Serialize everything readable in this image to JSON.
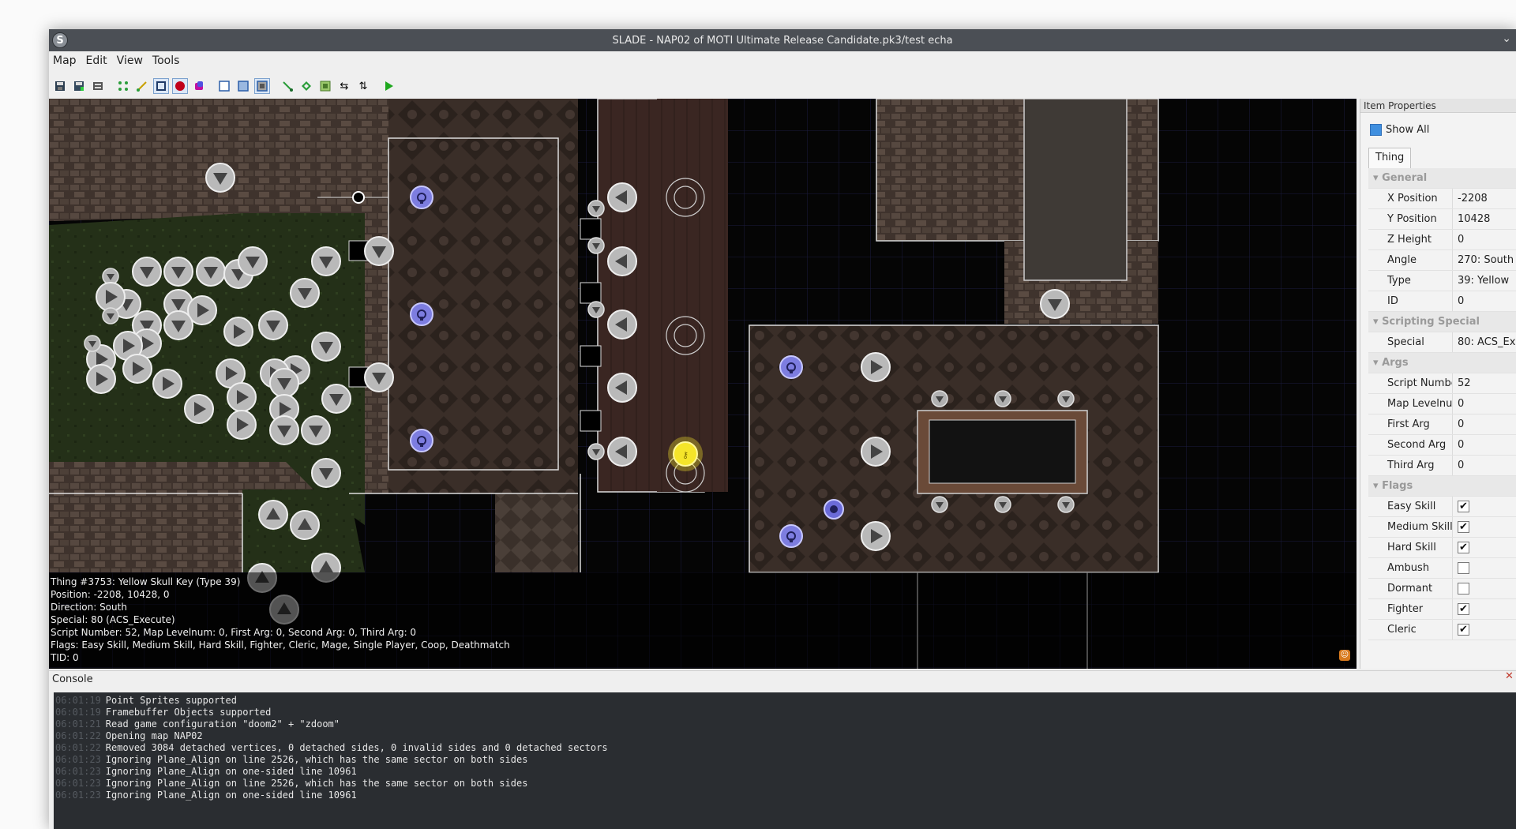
{
  "window": {
    "title": "SLADE - NAP02 of MOTI Ultimate Release Candidate.pk3/test echa",
    "app_icon": "slade-logo-icon"
  },
  "menu": [
    "Map",
    "Edit",
    "View",
    "Tools"
  ],
  "toolbar": {
    "icons": [
      "save-icon",
      "save-all-icon",
      "export-icon",
      "vertices-mode-icon",
      "lines-mode-icon",
      "sectors-mode-icon",
      "things-mode-icon",
      "3d-mode-icon",
      "flat-mode-icon",
      "floor-mode-icon",
      "ceiling-mode-icon",
      "grid-icon",
      "lines-draw-icon",
      "objects-icon",
      "editor-tags-icon",
      "swap-icon",
      "flip-icon",
      "play-icon"
    ]
  },
  "map_info": {
    "line1": "Thing #3753: Yellow Skull Key (Type 39)",
    "line2": "Position: -2208, 10428, 0",
    "line3": "Direction: South",
    "line4": "Special: 80 (ACS_Execute)",
    "line5": "Script Number: 52, Map Levelnum: 0, First Arg: 0, Second Arg: 0, Third Arg: 0",
    "line6": "Flags: Easy Skill, Medium Skill, Hard Skill, Fighter, Cleric, Mage, Single Player, Coop, Deathmatch",
    "line7": "TID: 0"
  },
  "props": {
    "title": "Item Properties",
    "show_all": "Show All",
    "tab": "Thing",
    "cat_general": "General",
    "x_label": "X Position",
    "x_value": "-2208",
    "y_label": "Y Position",
    "y_value": "10428",
    "z_label": "Z Height",
    "z_value": "0",
    "angle_label": "Angle",
    "angle_value": "270: South",
    "type_label": "Type",
    "type_value": "39: Yellow",
    "id_label": "ID",
    "id_value": "0",
    "cat_scripting": "Scripting Special",
    "special_label": "Special",
    "special_value": "80: ACS_Ex",
    "cat_args": "Args",
    "script_label": "Script Number",
    "script_value": "52",
    "maplevel_label": "Map Levelnum",
    "maplevel_value": "0",
    "first_label": "First Arg",
    "first_value": "0",
    "second_label": "Second Arg",
    "second_value": "0",
    "third_label": "Third Arg",
    "third_value": "0",
    "cat_flags": "Flags",
    "flags": [
      {
        "label": "Easy Skill",
        "checked": true
      },
      {
        "label": "Medium Skill",
        "checked": true
      },
      {
        "label": "Hard Skill",
        "checked": true
      },
      {
        "label": "Ambush",
        "checked": false
      },
      {
        "label": "Dormant",
        "checked": false
      },
      {
        "label": "Fighter",
        "checked": true
      },
      {
        "label": "Cleric",
        "checked": true
      }
    ]
  },
  "console": {
    "title": "Console",
    "lines": [
      {
        "ts": "06:01:19",
        "msg": "Point Sprites supported"
      },
      {
        "ts": "06:01:19",
        "msg": "Framebuffer Objects supported"
      },
      {
        "ts": "06:01:21",
        "msg": "Read game configuration \"doom2\" + \"zdoom\""
      },
      {
        "ts": "06:01:22",
        "msg": "Opening map NAP02"
      },
      {
        "ts": "06:01:22",
        "msg": "Removed 3084 detached vertices, 0 detached sides, 0 invalid sides and 0 detached sectors"
      },
      {
        "ts": "06:01:23",
        "msg": "Ignoring Plane_Align on line 2526, which has the same sector on both sides"
      },
      {
        "ts": "06:01:23",
        "msg": "Ignoring Plane_Align on one-sided line 10961"
      },
      {
        "ts": "06:01:23",
        "msg": "Ignoring Plane_Align on line 2526, which has the same sector on both sides"
      },
      {
        "ts": "06:01:23",
        "msg": "Ignoring Plane_Align on one-sided line 10961"
      }
    ]
  },
  "colors": {
    "titlebar": "#4b4f55",
    "console_bg": "#2a2d31",
    "map_bg": "#050505",
    "thing_fill": "#bdbdbd",
    "lamp": "#8f8fe6",
    "key_yellow": "#f5e52a"
  }
}
